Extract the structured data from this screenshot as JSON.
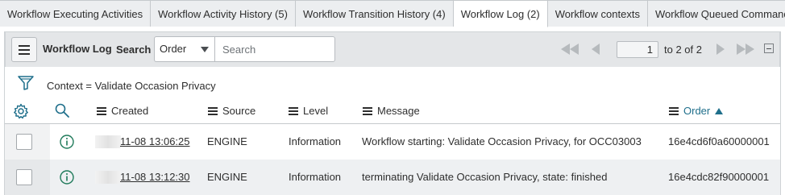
{
  "tabs": [
    {
      "label": "Workflow Executing Activities",
      "active": false
    },
    {
      "label": "Workflow Activity History (5)",
      "active": false
    },
    {
      "label": "Workflow Transition History (4)",
      "active": false
    },
    {
      "label": "Workflow Log (2)",
      "active": true
    },
    {
      "label": "Workflow contexts",
      "active": false
    },
    {
      "label": "Workflow Queued Commands",
      "active": false
    }
  ],
  "toolbar": {
    "menu_icon": "hamburger-menu-icon",
    "list_title": "Workflow Log",
    "search_label": "Search",
    "search_field": "Order",
    "search_placeholder": "Search",
    "page_current": "1",
    "page_range": "to 2 of 2"
  },
  "filter": {
    "icon": "funnel-filter-icon",
    "text": "Context = Validate Occasion Privacy"
  },
  "columns": {
    "created": "Created",
    "source": "Source",
    "level": "Level",
    "message": "Message",
    "order": "Order",
    "order_sort": "ascending"
  },
  "rows": [
    {
      "created": "11-08 13:06:25",
      "source": "ENGINE",
      "level": "Information",
      "message": "Workflow starting: Validate Occasion Privacy, for OCC03003",
      "order": "16e4cd6f0a60000001"
    },
    {
      "created": "11-08 13:12:30",
      "source": "ENGINE",
      "level": "Information",
      "message": "terminating Validate Occasion Privacy, state: finished",
      "order": "16e4cdc82f90000001"
    }
  ],
  "colors": {
    "accent": "#1f6f8b",
    "toolbar_bg": "#e4e6e8",
    "tab_bg": "#eceef0"
  }
}
